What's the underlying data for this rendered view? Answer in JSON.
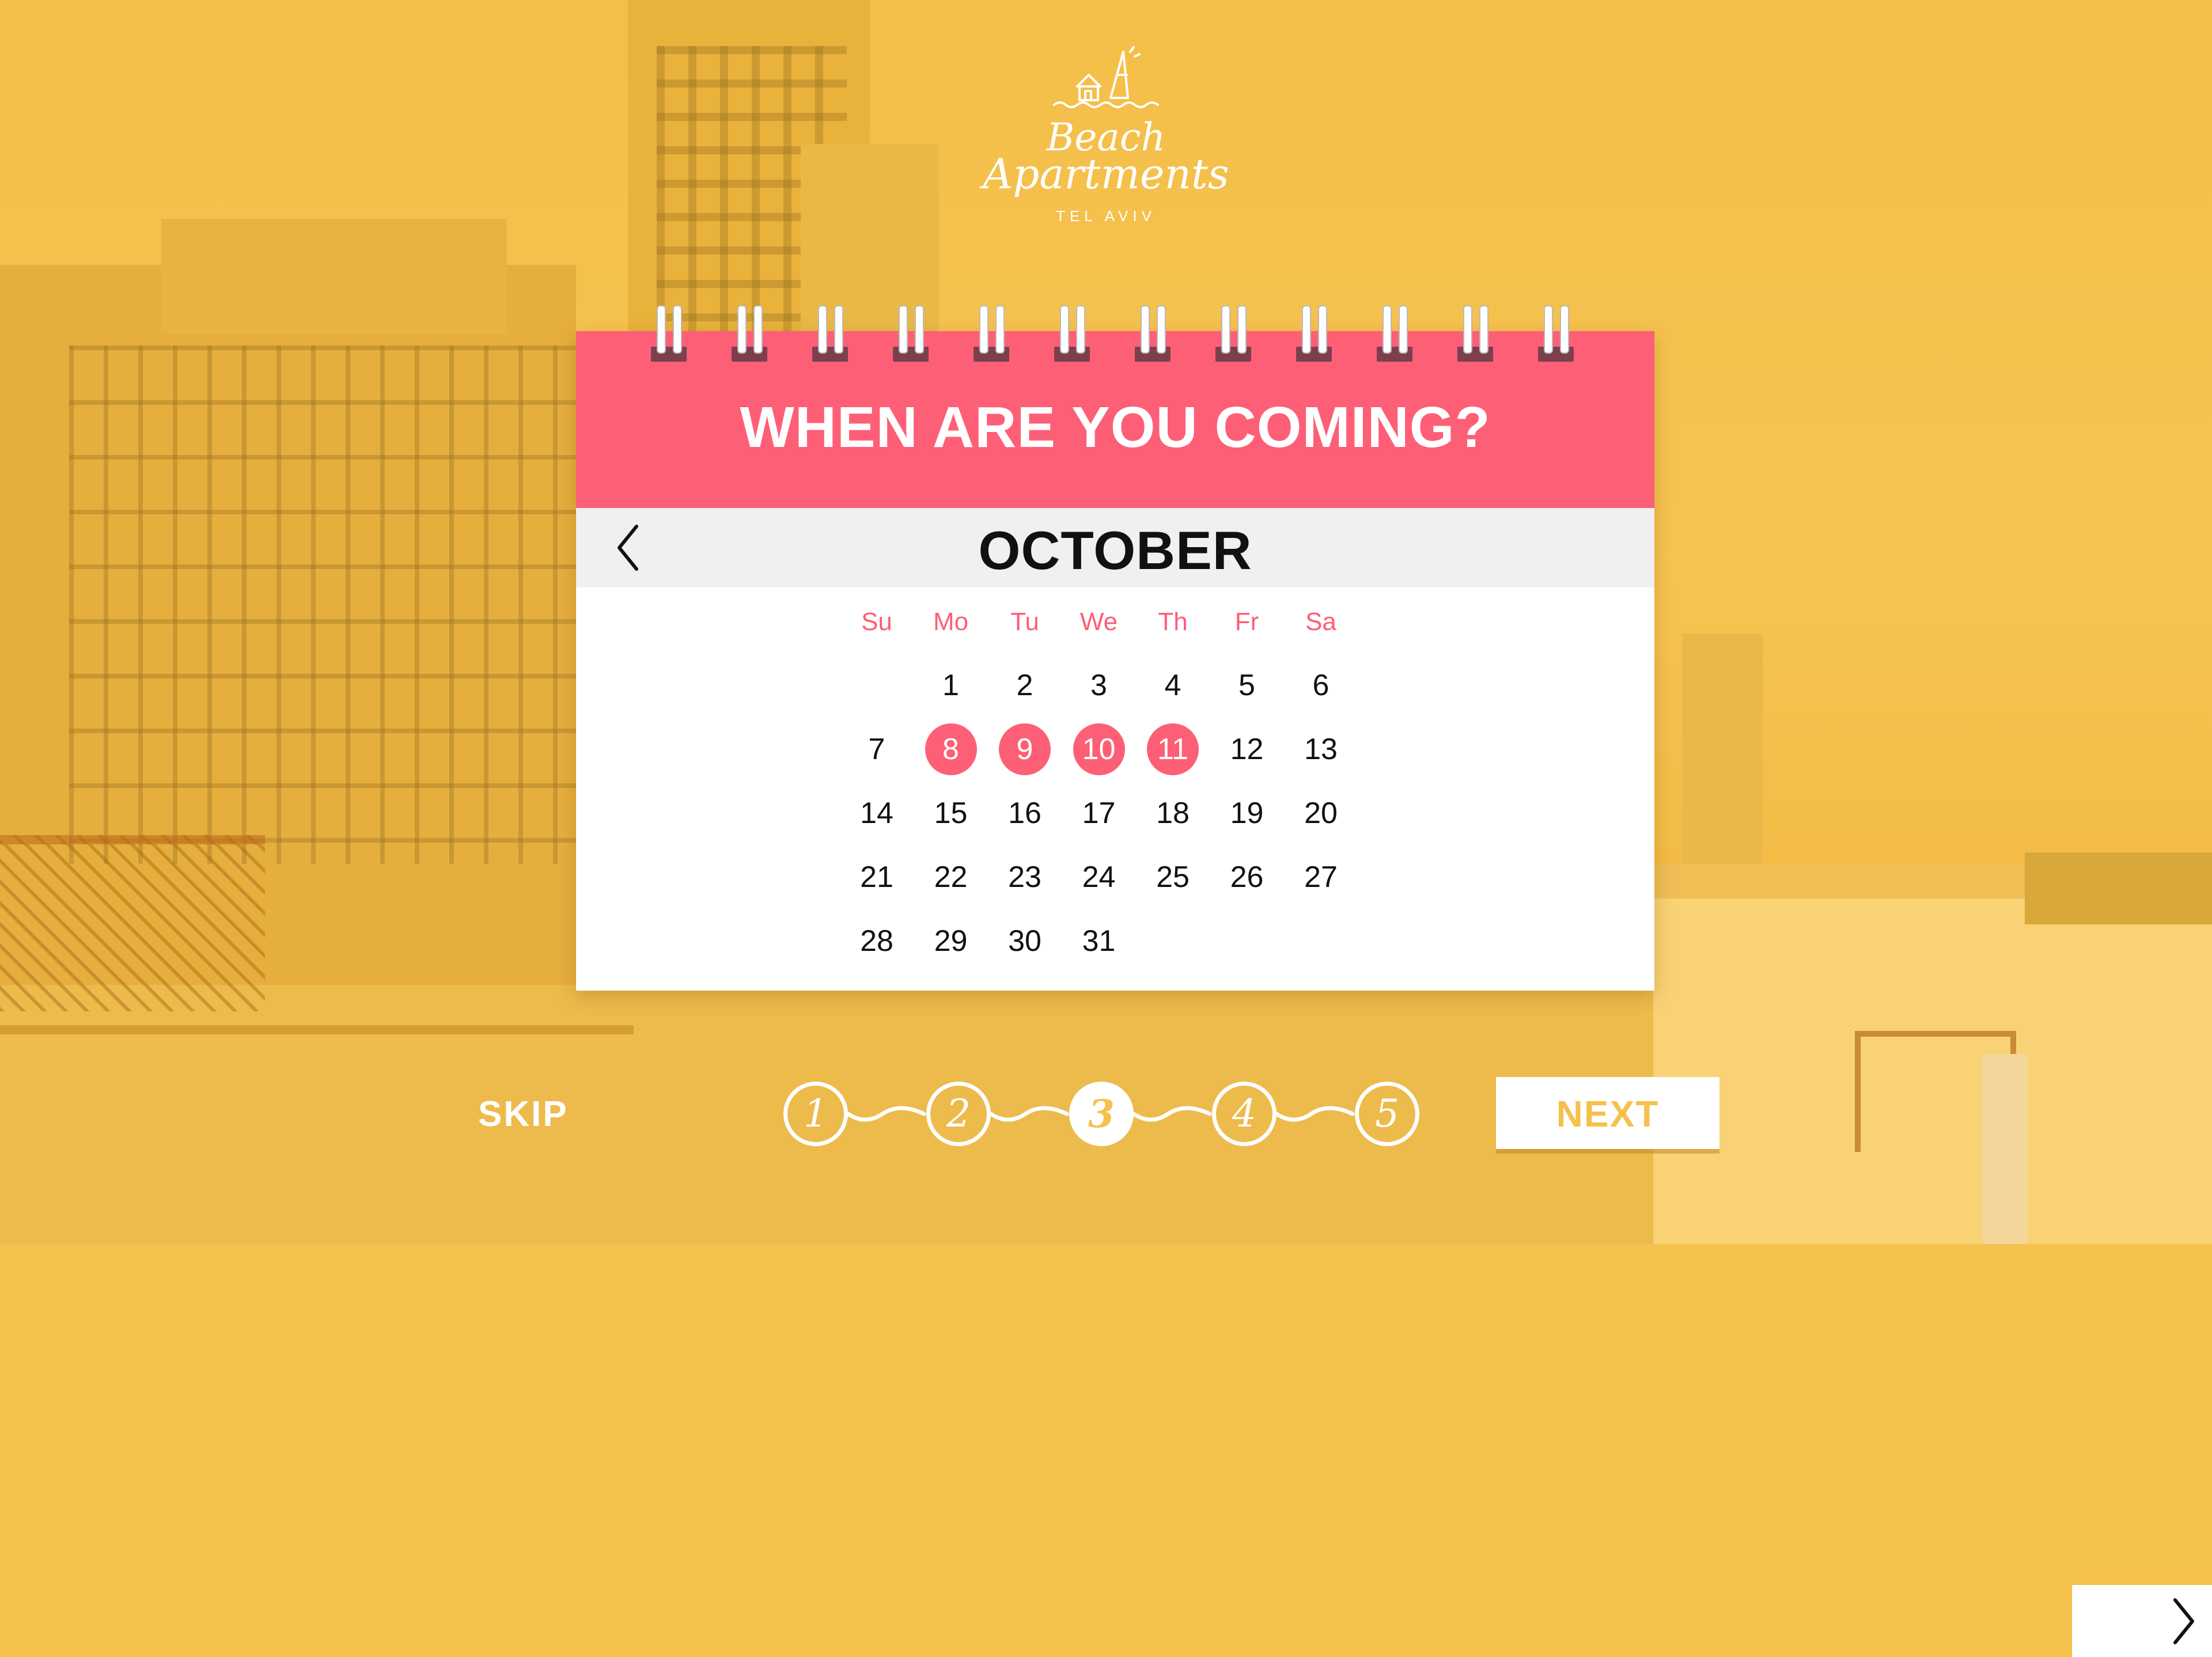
{
  "logo": {
    "title_line1": "Beach",
    "title_line2": "Apartments",
    "subtitle": "TEL AVIV",
    "icon": "beach-house-icon"
  },
  "calendar": {
    "heading": "WHEN ARE YOU COMING?",
    "month": "OCTOBER",
    "prev_icon": "chevron-left-icon",
    "next_icon": "chevron-right-icon",
    "weekdays": [
      "Su",
      "Mo",
      "Tu",
      "We",
      "Th",
      "Fr",
      "Sa"
    ],
    "first_weekday_index": 1,
    "days_in_month": 31,
    "selected_days": [
      8,
      9,
      10,
      11
    ]
  },
  "footer": {
    "skip_label": "SKIP",
    "next_label": "NEXT",
    "steps": [
      "1",
      "2",
      "3",
      "4",
      "5"
    ],
    "active_step": 3
  },
  "colors": {
    "accent_pink": "#fd5f77",
    "background_yellow": "#f5c14d",
    "ring_hole": "#7d3f4e"
  }
}
